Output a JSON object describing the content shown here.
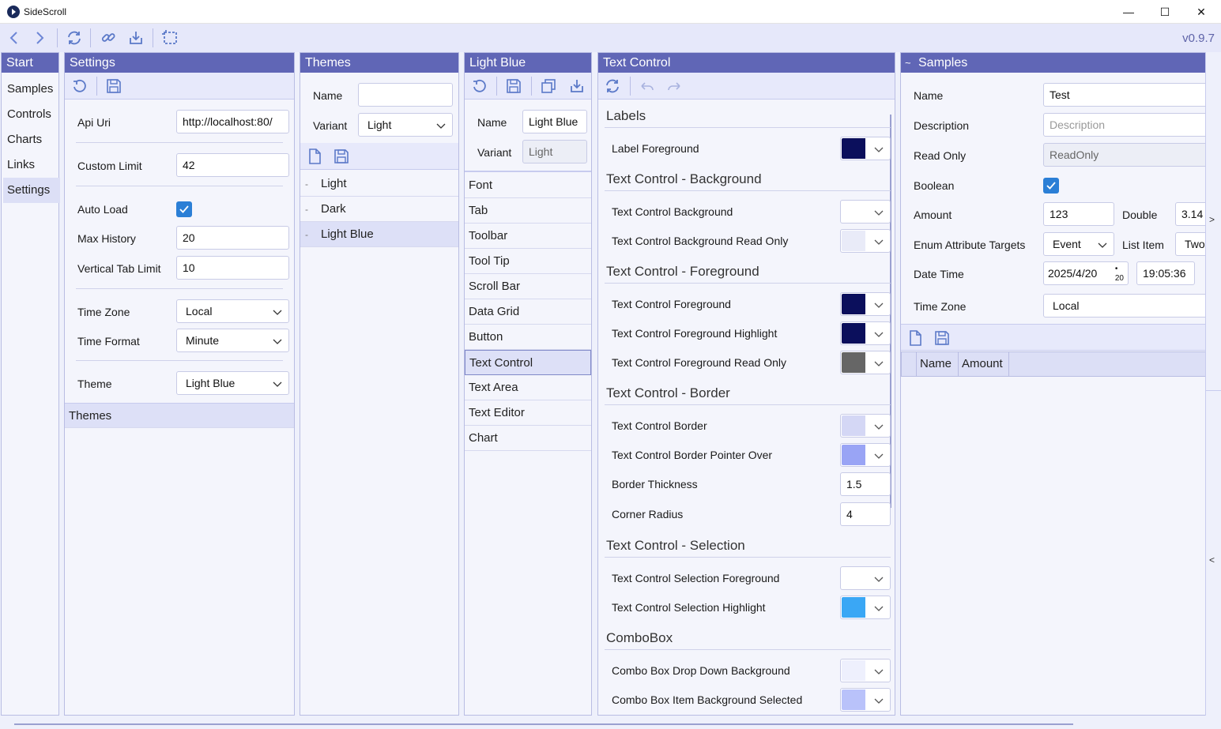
{
  "window": {
    "title": "SideScroll",
    "minimize": "—",
    "maximize": "☐",
    "close": "✕"
  },
  "toolbar": {
    "version": "v0.9.7"
  },
  "nav": {
    "header": "Start",
    "items": [
      "Samples",
      "Controls",
      "Charts",
      "Links",
      "Settings"
    ],
    "selected": "Settings"
  },
  "settings": {
    "header": "Settings",
    "fields": {
      "api_uri_label": "Api Uri",
      "api_uri_value": "http://localhost:80/",
      "custom_limit_label": "Custom Limit",
      "custom_limit_value": "42",
      "auto_load_label": "Auto Load",
      "max_history_label": "Max History",
      "max_history_value": "20",
      "vertical_tab_limit_label": "Vertical Tab Limit",
      "vertical_tab_limit_value": "10",
      "time_zone_label": "Time Zone",
      "time_zone_value": "Local",
      "time_format_label": "Time Format",
      "time_format_value": "Minute",
      "theme_label": "Theme",
      "theme_value": "Light Blue"
    },
    "themes_item": "Themes"
  },
  "themes": {
    "header": "Themes",
    "name_label": "Name",
    "name_value": "",
    "variant_label": "Variant",
    "variant_value": "Light",
    "items": [
      "Light",
      "Dark",
      "Light Blue"
    ],
    "selected": "Light Blue"
  },
  "lightblue": {
    "header": "Light Blue",
    "name_label": "Name",
    "name_value": "Light Blue",
    "variant_label": "Variant",
    "variant_value": "Light",
    "items": [
      "Font",
      "Tab",
      "Toolbar",
      "Tool Tip",
      "Scroll Bar",
      "Data Grid",
      "Button",
      "Text Control",
      "Text Area",
      "Text Editor",
      "Chart"
    ],
    "selected": "Text Control"
  },
  "textcontrol": {
    "header": "Text Control",
    "sections": {
      "labels": "Labels",
      "background": "Text Control - Background",
      "foreground": "Text Control - Foreground",
      "border": "Text Control - Border",
      "selection": "Text Control - Selection",
      "combobox": "ComboBox"
    },
    "rows": {
      "label_foreground": "Label Foreground",
      "tc_background": "Text Control Background",
      "tc_background_ro": "Text Control Background Read Only",
      "tc_foreground": "Text Control Foreground",
      "tc_foreground_hl": "Text Control Foreground Highlight",
      "tc_foreground_ro": "Text Control Foreground Read Only",
      "tc_border": "Text Control Border",
      "tc_border_po": "Text Control Border Pointer Over",
      "border_thickness": "Border Thickness",
      "border_thickness_value": "1.5",
      "corner_radius": "Corner Radius",
      "corner_radius_value": "4",
      "sel_foreground": "Text Control Selection Foreground",
      "sel_highlight": "Text Control Selection Highlight",
      "cb_dropdown_bg": "Combo Box Drop Down Background",
      "cb_item_bg_sel": "Combo Box Item Background Selected"
    },
    "colors": {
      "label_foreground": "#0b0f5c",
      "tc_background": "#ffffff",
      "tc_background_ro": "#e9ebf8",
      "tc_foreground": "#0b0f5c",
      "tc_foreground_hl": "#0b0f5c",
      "tc_foreground_ro": "#666666",
      "tc_border": "#d4d7f5",
      "tc_border_po": "#99a4f5",
      "sel_foreground": "#ffffff",
      "sel_highlight": "#3aa7f5",
      "cb_dropdown_bg": "#eef0fd",
      "cb_item_bg_sel": "#b9c2fa"
    }
  },
  "samples": {
    "header": "Samples",
    "collapse": "~",
    "name_label": "Name",
    "name_value": "Test",
    "description_label": "Description",
    "description_placeholder": "Description",
    "read_only_label": "Read Only",
    "read_only_value": "ReadOnly",
    "boolean_label": "Boolean",
    "amount_label": "Amount",
    "amount_value": "123",
    "double_label": "Double",
    "double_value": "3.14",
    "enum_label": "Enum Attribute Targets",
    "enum_value": "Event",
    "list_item_label": "List Item",
    "list_item_value": "Two",
    "date_time_label": "Date Time",
    "date_value": "2025/4/20",
    "date_day": "20",
    "time_value": "19:05:36",
    "time_zone_label": "Time Zone",
    "time_zone_value": "Local",
    "grid_columns": [
      "Name",
      "Amount"
    ]
  },
  "right_rail": {
    "expand": ">",
    "collapse": "<"
  }
}
